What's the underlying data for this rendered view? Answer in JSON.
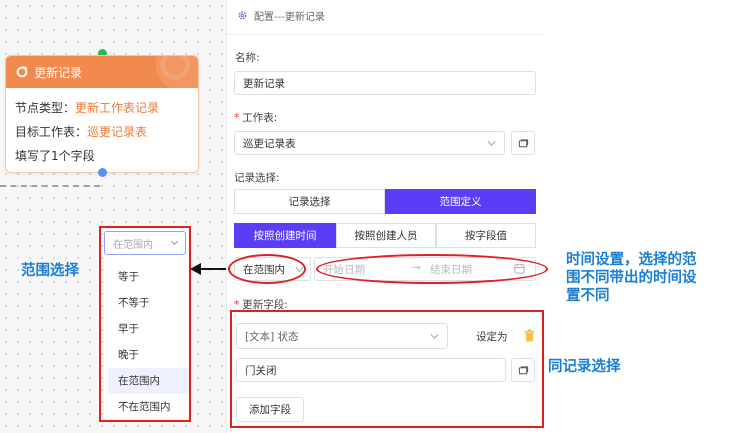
{
  "node": {
    "title": "更新记录",
    "type_label": "节点类型：",
    "type_value": "更新工作表记录",
    "target_label": "目标工作表：",
    "target_value": "巡更记录表",
    "fields_summary": "填写了1个字段"
  },
  "dropdown": {
    "placeholder": "在范围内",
    "options": [
      "等于",
      "不等于",
      "早于",
      "晚于",
      "在范围内",
      "不在范围内"
    ],
    "selected": "在范围内"
  },
  "panel": {
    "title": "配置---更新记录",
    "name_label": "名称:",
    "name_value": "更新记录",
    "sheet_label": "工作表:",
    "sheet_value": "巡更记录表",
    "record_select_label": "记录选择:",
    "record_tabs": [
      "记录选择",
      "范围定义"
    ],
    "record_tab_active": 1,
    "range_tabs": [
      "按照创建时间",
      "按照创建人员",
      "按字段值"
    ],
    "range_tab_active": 0,
    "condition_value": "在范围内",
    "start_date_placeholder": "开始日期",
    "date_separator": "→",
    "end_date_placeholder": "结束日期",
    "update_fields_label": "更新字段:",
    "field_name": "[文本] 状态",
    "set_as_label": "设定为",
    "field_value": "门关闭",
    "add_field_button": "添加字段"
  },
  "annotations": {
    "range_select": "范围选择",
    "time_setting": "时间设置，选择的范围不同带出的时间设置不同",
    "same_as_record_select": "同记录选择"
  },
  "colors": {
    "accent": "#5b3df5",
    "node_header": "#f2894d",
    "node_highlight": "#f07a36",
    "annotation_text": "#1a7fd4",
    "annotation_box": "#e02020",
    "delete_icon": "#f5c244"
  }
}
